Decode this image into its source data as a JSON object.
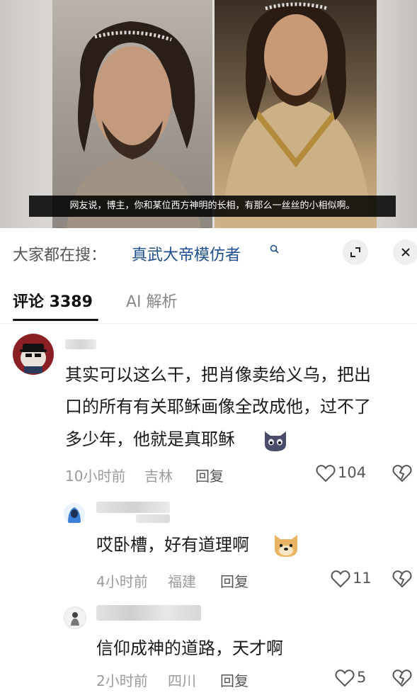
{
  "video": {
    "subtitle": "网友说，博主，你和某位西方神明的长相，有那么一丝丝的小相似啊。"
  },
  "search": {
    "prefix": "大家都在搜：",
    "term": "真武大帝模仿者"
  },
  "tabs": [
    {
      "label": "评论 3389",
      "active": true
    },
    {
      "label": "AI 解析",
      "active": false
    }
  ],
  "comments": [
    {
      "lines": [
        "其实可以这么干，把肖像卖给义乌，把出",
        "口的所有有关耶稣画像全改成他，过不了",
        "多少年，他就是真耶稣"
      ],
      "emoji": "cat-face-emoji",
      "time": "10小时前",
      "location": "吉林",
      "reply_label": "回复",
      "likes": "104"
    },
    {
      "lines": [
        "哎卧槽，好有道理啊"
      ],
      "emoji": "doge-emoji",
      "time": "4小时前",
      "location": "福建",
      "reply_label": "回复",
      "likes": "11"
    },
    {
      "lines": [
        "信仰成神的道路，天才啊"
      ],
      "time": "2小时前",
      "location": "四川",
      "reply_label": "回复",
      "likes": "5"
    }
  ],
  "colors": {
    "search_term": "#1f4f8f",
    "meta": "#9b9b9b",
    "text": "#1a1a1a"
  }
}
